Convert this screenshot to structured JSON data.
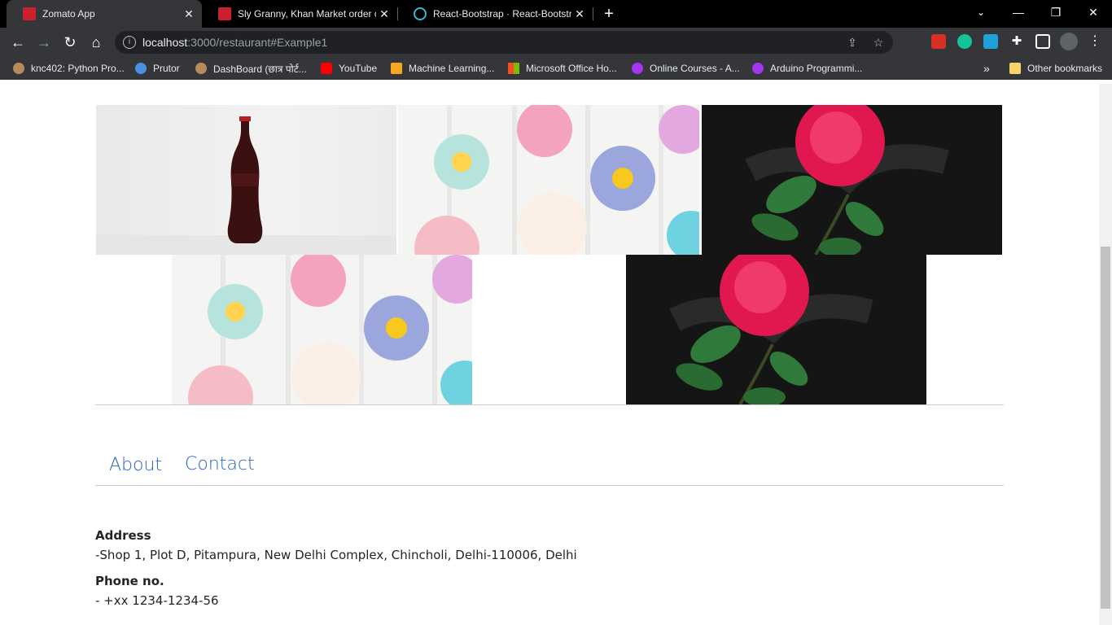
{
  "browser": {
    "tabs": [
      {
        "title": "Zomato App",
        "favicon_color": "#cb202d",
        "active": true
      },
      {
        "title": "Sly Granny, Khan Market order o",
        "favicon_color": "#cb202d",
        "active": false
      },
      {
        "title": "React-Bootstrap · React-Bootstrap",
        "favicon_color": "#41b4d3",
        "active": false
      }
    ],
    "url_host": "localhost",
    "url_rest": ":3000/restaurant#Example1",
    "bookmarks": [
      {
        "label": "knc402: Python Pro...",
        "icon_color": "#b88b5a"
      },
      {
        "label": "Prutor",
        "icon_color": "#4a90e2"
      },
      {
        "label": "DashBoard (छात्र पोर्ट...",
        "icon_color": "#b88b5a"
      },
      {
        "label": "YouTube",
        "icon_color": "#ff0000"
      },
      {
        "label": "Machine Learning...",
        "icon_color": "#f5a623"
      },
      {
        "label": "Microsoft Office Ho...",
        "icon_color": "#f25022"
      },
      {
        "label": "Online Courses - A...",
        "icon_color": "#a435f0"
      },
      {
        "label": "Arduino Programmi...",
        "icon_color": "#a435f0"
      },
      {
        "label": "Other bookmarks",
        "icon_color": "#f6d36b"
      }
    ],
    "more_bookmarks": "»"
  },
  "gallery": {
    "row1": [
      {
        "alt": "coca-cola-bottle"
      },
      {
        "alt": "flower-cupcakes"
      },
      {
        "alt": "red-rose"
      }
    ],
    "row2": [
      {
        "alt": "flower-cupcakes"
      },
      {
        "alt": "red-rose"
      }
    ]
  },
  "tabs": {
    "about": "About",
    "contact": "Contact"
  },
  "contact": {
    "address_label": "Address",
    "address_value": "-Shop 1, Plot D, Pitampura, New Delhi Complex, Chincholi, Delhi-110006, Delhi",
    "phone_label": "Phone no.",
    "phone_value": "- +xx 1234-1234-56"
  },
  "colors": {
    "link": "#2a64c5",
    "text": "#212529"
  }
}
